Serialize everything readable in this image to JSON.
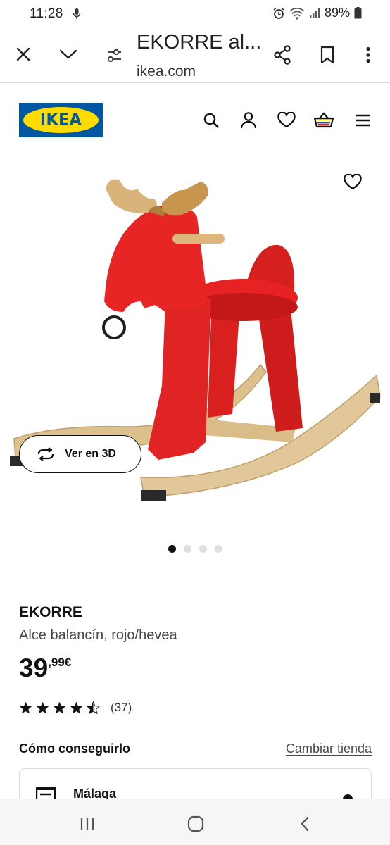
{
  "status_bar": {
    "time": "11:28",
    "battery": "89%",
    "icons": [
      "mic-icon",
      "alarm-icon",
      "wifi-icon",
      "signal-icon",
      "battery-icon"
    ]
  },
  "browser": {
    "title": "EKORRE al...",
    "url": "ikea.com",
    "icons": [
      "close-icon",
      "chevron-down-icon",
      "page-settings-icon",
      "share-icon",
      "bookmark-icon",
      "more-icon"
    ]
  },
  "header": {
    "logo_text": "IKEA",
    "logo_colors": {
      "blue": "#0058a3",
      "yellow": "#ffdb00"
    },
    "icons": [
      "search-icon",
      "account-icon",
      "favorites-icon",
      "cart-icon",
      "menu-icon"
    ]
  },
  "gallery": {
    "view_3d_label": "Ver en 3D",
    "image_count": 4,
    "active_image": 1
  },
  "product": {
    "name": "EKORRE",
    "description": "Alce balancín, rojo/hevea",
    "price_integer": "39",
    "price_decimal": ",99€",
    "rating_value": 4.5,
    "rating_max": 5,
    "review_count": "(37)"
  },
  "availability": {
    "title": "Cómo conseguirlo",
    "change_store_label": "Cambiar tienda",
    "store_name": "Málaga"
  },
  "nav_bar": {
    "icons": [
      "recent-apps-icon",
      "home-icon",
      "back-icon"
    ]
  }
}
